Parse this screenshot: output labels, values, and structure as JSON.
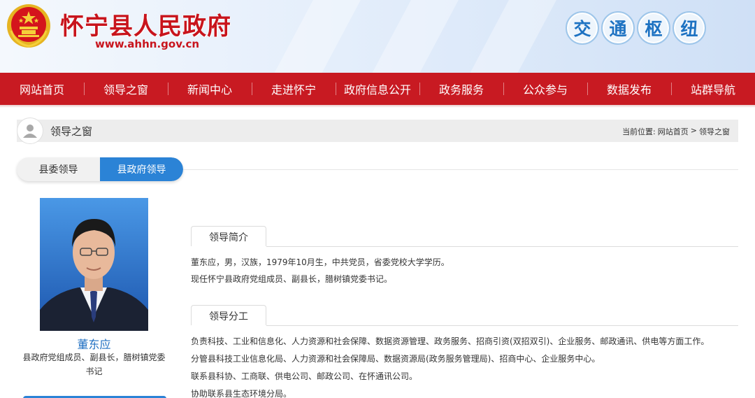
{
  "header": {
    "site_title": "怀宁县人民政府",
    "site_url": "www.ahhn.gov.cn",
    "hub_chars": [
      "交",
      "通",
      "枢",
      "纽"
    ],
    "brand_color": "#c81a22",
    "emblem_icon": "national-emblem-icon"
  },
  "nav": {
    "items": [
      "网站首页",
      "领导之窗",
      "新闻中心",
      "走进怀宁",
      "政府信息公开",
      "政务服务",
      "公众参与",
      "数据发布",
      "站群导航"
    ]
  },
  "breadcrumb": {
    "section_title": "领导之窗",
    "prefix": "当前位置:",
    "home": "网站首页",
    "separator": ">",
    "current": "领导之窗",
    "icon": "user-icon"
  },
  "tabs": {
    "items": [
      "县委领导",
      "县政府领导"
    ],
    "active": "县政府领导",
    "accent_color": "#2b83d6"
  },
  "leader": {
    "name": "董东应",
    "posts_line1": "县政府党组成员、副县长，腊树镇党委",
    "posts_line2": "书记"
  },
  "profile": {
    "heading": "领导简介",
    "line1": "董东应，男，汉族，1979年10月生，中共党员，省委党校大学学历。",
    "line2": "现任怀宁县政府党组成员、副县长，腊树镇党委书记。"
  },
  "duties": {
    "heading": "领导分工",
    "line1": "负责科技、工业和信息化、人力资源和社会保障、数据资源管理、政务服务、招商引资(双招双引)、企业服务、邮政通讯、供电等方面工作。",
    "line2": "分管县科技工业信息化局、人力资源和社会保障局、数据资源局(政务服务管理局)、招商中心、企业服务中心。",
    "line3": "联系县科协、工商联、供电公司、邮政公司、在怀通讯公司。",
    "line4": "协助联系县生态环境分局。"
  }
}
